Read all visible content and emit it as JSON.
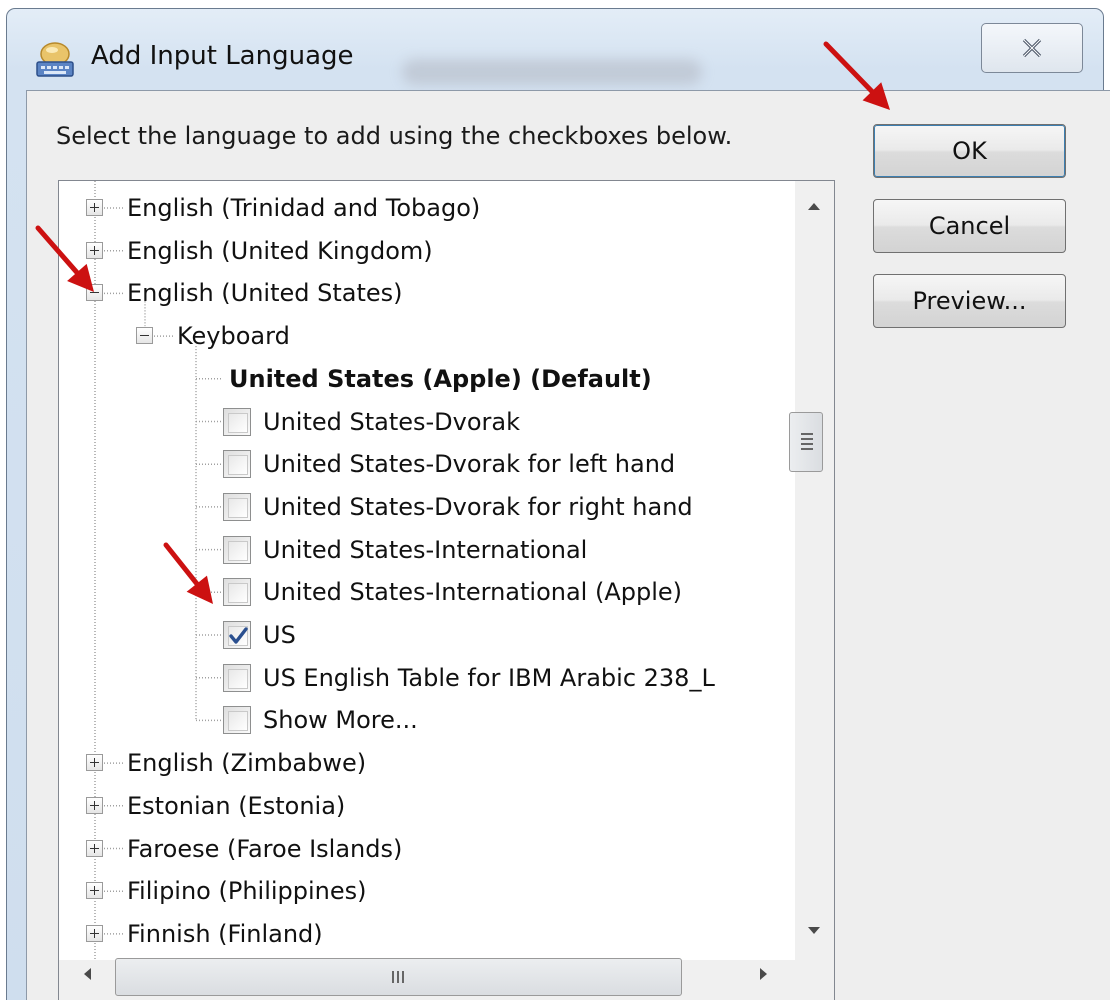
{
  "window": {
    "title": "Add Input Language",
    "close_icon": "close-icon"
  },
  "instruction": "Select the language to add using the checkboxes below.",
  "buttons": {
    "ok": "OK",
    "cancel": "Cancel",
    "preview": "Preview..."
  },
  "tree": {
    "items": [
      {
        "label": "English (Trinidad and Tobago)",
        "expander": "plus"
      },
      {
        "label": "English (United Kingdom)",
        "expander": "plus"
      },
      {
        "label": "English (United States)",
        "expander": "minus"
      },
      {
        "label": "Keyboard",
        "expander": "minus"
      },
      {
        "label": "United States (Apple) (Default)",
        "bold": true
      },
      {
        "label": "United States-Dvorak",
        "checked": false
      },
      {
        "label": "United States-Dvorak for left hand",
        "checked": false
      },
      {
        "label": "United States-Dvorak for right hand",
        "checked": false
      },
      {
        "label": "United States-International",
        "checked": false
      },
      {
        "label": "United States-International (Apple)",
        "checked": false
      },
      {
        "label": "US",
        "checked": true
      },
      {
        "label": "US English Table for IBM Arabic 238_L",
        "checked": false
      },
      {
        "label": "Show More...",
        "checked": false
      },
      {
        "label": "English (Zimbabwe)",
        "expander": "plus"
      },
      {
        "label": "Estonian (Estonia)",
        "expander": "plus"
      },
      {
        "label": "Faroese (Faroe Islands)",
        "expander": "plus"
      },
      {
        "label": "Filipino (Philippines)",
        "expander": "plus"
      },
      {
        "label": "Finnish (Finland)",
        "expander": "plus"
      }
    ],
    "scrollbar_grip": "III"
  },
  "annotations": {
    "arrow_color": "#cc1111"
  },
  "colors": {
    "frame": "#d4e2f1",
    "client": "#eeeeee",
    "checkmark": "#2a4f8f"
  }
}
